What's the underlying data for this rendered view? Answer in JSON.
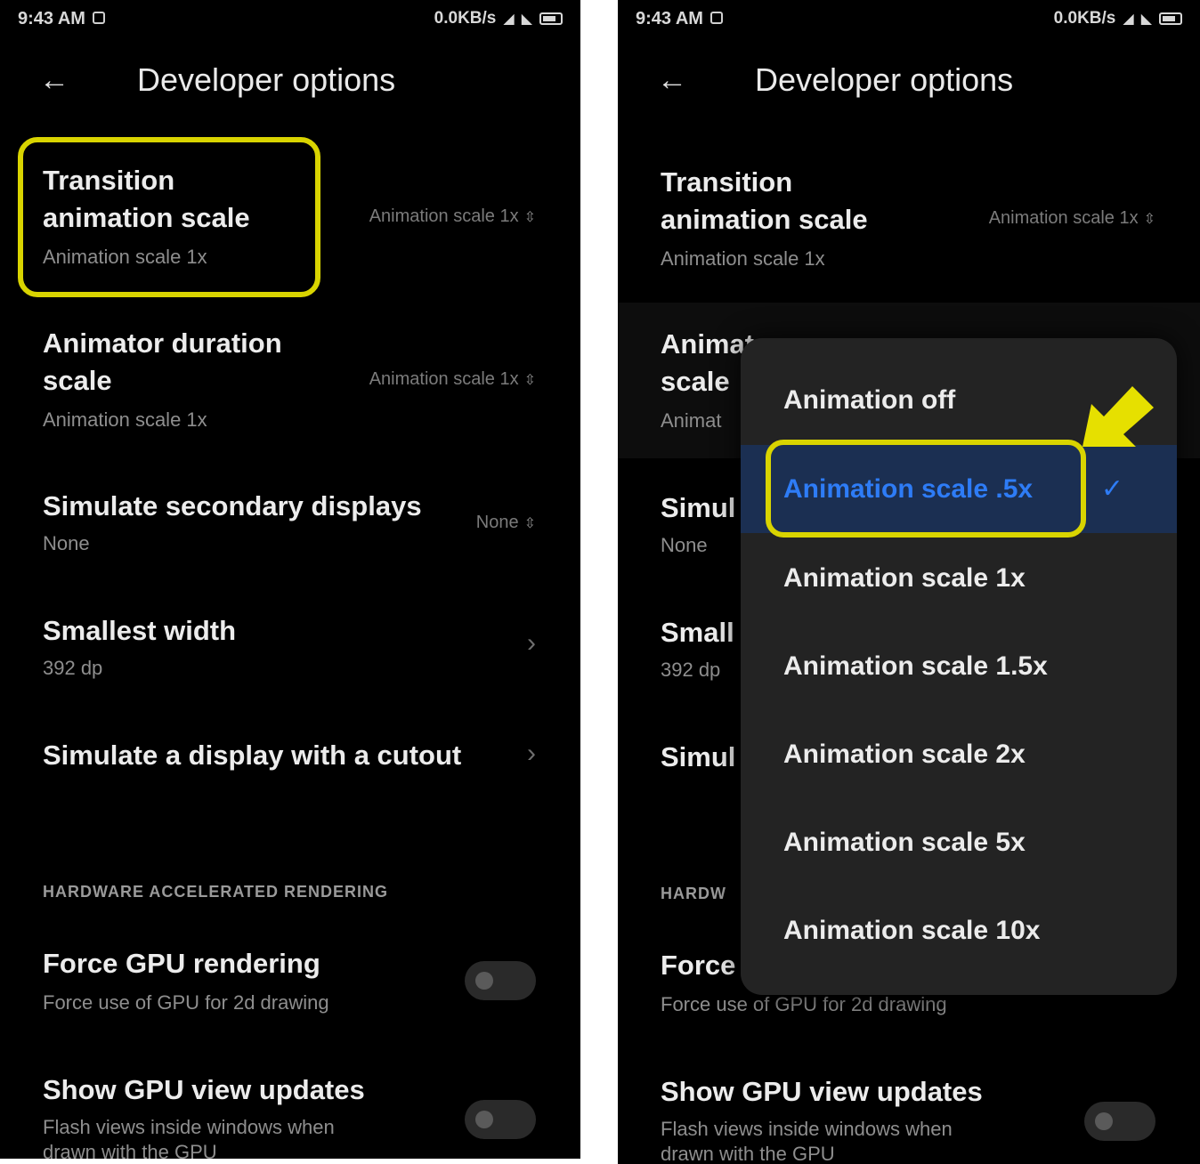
{
  "colors": {
    "highlight": "#d9d400",
    "accent": "#2e7cf6",
    "selected_row": "#1b2f52",
    "background": "#000000"
  },
  "status_bar": {
    "time": "9:43 AM",
    "net_speed": "0.0KB/s"
  },
  "app_bar": {
    "title": "Developer options",
    "back_icon": "arrow-left-icon"
  },
  "left": {
    "items": [
      {
        "title_line1": "Transition",
        "title_line2": "animation scale",
        "summary": "Animation scale 1x",
        "value": "Animation scale 1x"
      },
      {
        "title_line1": "Animator duration",
        "title_line2": "scale",
        "summary": "Animation scale 1x",
        "value": "Animation scale 1x"
      },
      {
        "title": "Simulate secondary displays",
        "summary": "None",
        "value": "None"
      },
      {
        "title": "Smallest width",
        "summary": "392 dp"
      },
      {
        "title": "Simulate a display with a cutout"
      }
    ],
    "section_header": "HARDWARE ACCELERATED RENDERING",
    "toggles": [
      {
        "title": "Force GPU rendering",
        "summary": "Force use of GPU for 2d drawing",
        "on": false
      },
      {
        "title": "Show GPU view updates",
        "summary": "Flash views inside windows when",
        "summary2": "drawn with the GPU",
        "on": false
      }
    ]
  },
  "right": {
    "items": [
      {
        "title_line1": "Transition",
        "title_line2": "animation scale",
        "summary": "Animation scale 1x",
        "value": "Animation scale 1x"
      },
      {
        "title_line1": "Animat",
        "title_line2": "scale",
        "summary": "Animat"
      },
      {
        "title": "Simul",
        "summary": "None"
      },
      {
        "title": "Small",
        "summary": "392 dp"
      },
      {
        "title": "Simul"
      }
    ],
    "section_header": "HARDW",
    "toggles": [
      {
        "title": "Force",
        "summary": "Force use of GPU for 2d drawing",
        "on": false
      },
      {
        "title": "Show GPU view updates",
        "summary": "Flash views inside windows when",
        "summary2": "drawn with the GPU",
        "on": false
      }
    ]
  },
  "dropdown": {
    "options": [
      "Animation off",
      "Animation scale .5x",
      "Animation scale 1x",
      "Animation scale 1.5x",
      "Animation scale 2x",
      "Animation scale 5x",
      "Animation scale 10x"
    ],
    "selected_index": 1,
    "check_icon": "check-icon"
  },
  "annotations": {
    "arrow_icon": "yellow-arrow-icon"
  }
}
